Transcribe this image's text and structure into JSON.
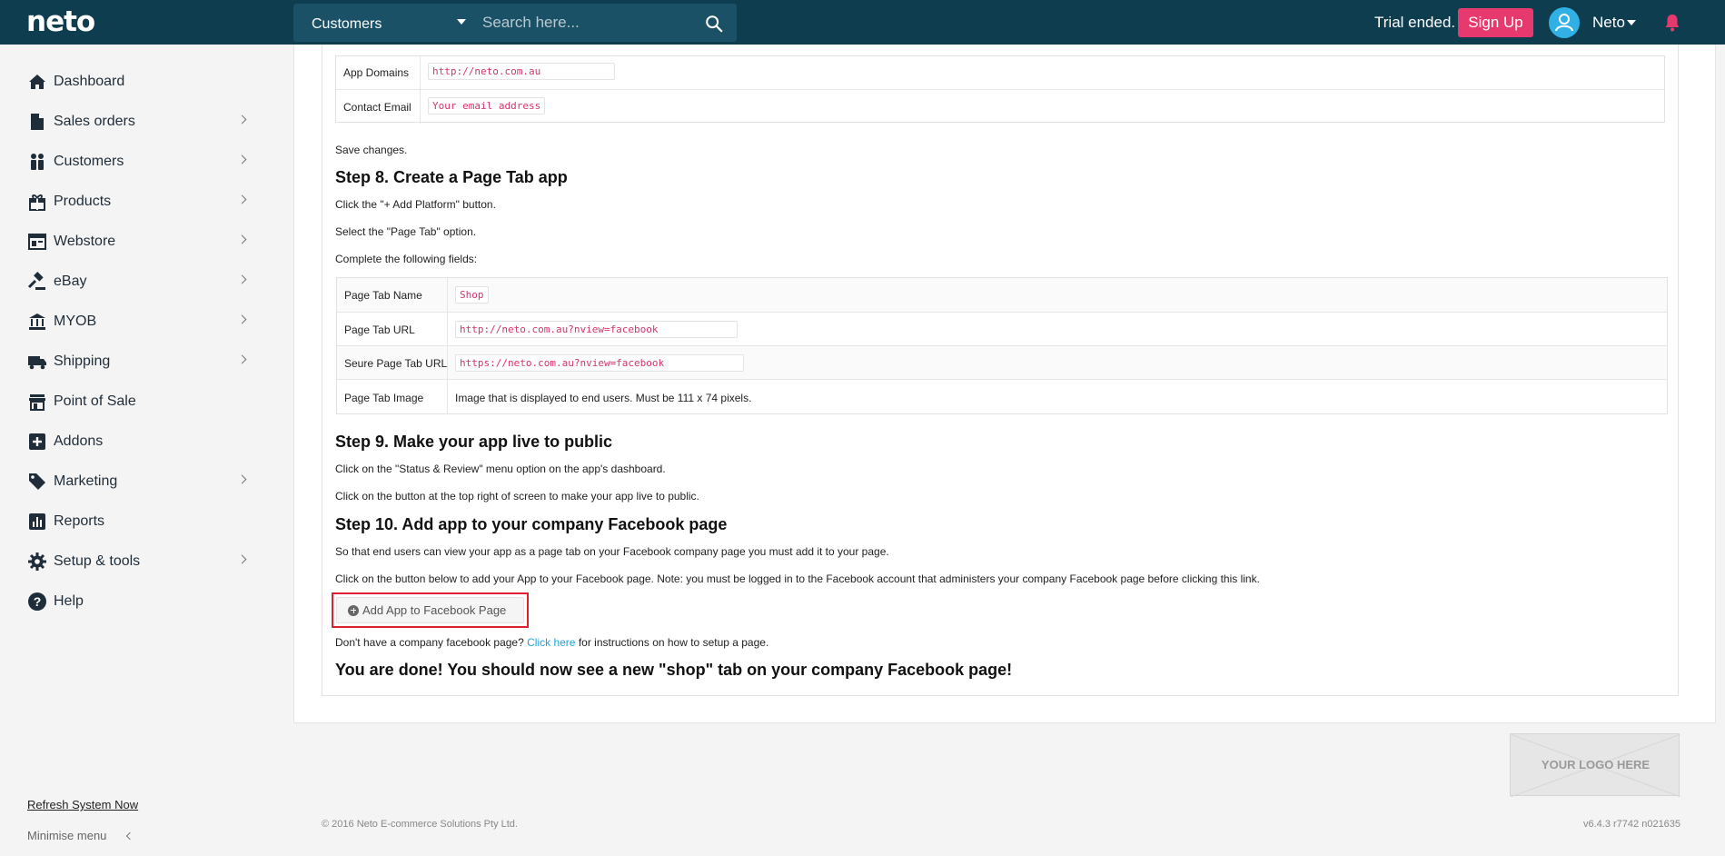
{
  "header": {
    "logo": "neto",
    "search_scope": "Customers",
    "search_placeholder": "Search here...",
    "trial_text": "Trial ended.",
    "signup_label": "Sign Up",
    "user_name": "Neto"
  },
  "sidebar": {
    "items": [
      {
        "label": "Dashboard",
        "icon": "home-icon",
        "has_children": false
      },
      {
        "label": "Sales orders",
        "icon": "document-icon",
        "has_children": true
      },
      {
        "label": "Customers",
        "icon": "people-icon",
        "has_children": true
      },
      {
        "label": "Products",
        "icon": "gift-icon",
        "has_children": true
      },
      {
        "label": "Webstore",
        "icon": "browser-icon",
        "has_children": true
      },
      {
        "label": "eBay",
        "icon": "gavel-icon",
        "has_children": true
      },
      {
        "label": "MYOB",
        "icon": "bank-icon",
        "has_children": true
      },
      {
        "label": "Shipping",
        "icon": "truck-icon",
        "has_children": true
      },
      {
        "label": "Point of Sale",
        "icon": "store-icon",
        "has_children": false
      },
      {
        "label": "Addons",
        "icon": "plus-square-icon",
        "has_children": false
      },
      {
        "label": "Marketing",
        "icon": "tag-icon",
        "has_children": true
      },
      {
        "label": "Reports",
        "icon": "bar-chart-icon",
        "has_children": false
      },
      {
        "label": "Setup & tools",
        "icon": "gear-icon",
        "has_children": true
      },
      {
        "label": "Help",
        "icon": "help-circle-icon",
        "has_children": false
      }
    ],
    "refresh_label": "Refresh System Now",
    "minimise_label": "Minimise menu"
  },
  "main": {
    "table1": {
      "rows": [
        {
          "label": "App Domains",
          "value": "http://neto.com.au"
        },
        {
          "label": "Contact Email",
          "value": "Your email address"
        }
      ]
    },
    "save_changes": "Save changes.",
    "step8": {
      "title": "Step 8. Create a Page Tab app",
      "lines": [
        "Click the \"+ Add Platform\" button.",
        "Select the \"Page Tab\" option.",
        "Complete the following fields:"
      ]
    },
    "table2": {
      "rows": [
        {
          "label": "Page Tab Name",
          "value": "Shop",
          "code": true
        },
        {
          "label": "Page Tab URL",
          "value": "http://neto.com.au?nview=facebook",
          "code": true
        },
        {
          "label": "Seure Page Tab URL",
          "value": "https://neto.com.au?nview=facebook",
          "code": true
        },
        {
          "label": "Page Tab Image",
          "value": "Image that is displayed to end users. Must be 111 x 74 pixels.",
          "code": false
        }
      ]
    },
    "step9": {
      "title": "Step 9. Make your app live to public",
      "lines": [
        "Click on the \"Status & Review\" menu option on the app's dashboard.",
        "Click on the button at the top right of screen to make your app live to public."
      ]
    },
    "step10": {
      "title": "Step 10. Add app to your company Facebook page",
      "lines": [
        "So that end users can view your app as a page tab on your Facebook company page you must add it to your page.",
        "Click on the button below to add your App to your Facebook page. Note: you must be logged in to the Facebook account that administers your company Facebook page before clicking this link."
      ],
      "button_label": "Add App to Facebook Page",
      "help_prefix": "Don't have a company facebook page?",
      "help_link": "Click here",
      "help_suffix": "for instructions on how to setup a page."
    },
    "done_text": "You are done! You should now see a new \"shop\" tab on your company Facebook page!"
  },
  "footer": {
    "logo_placeholder": "YOUR LOGO HERE",
    "copyright": "© 2016 Neto E-commerce Solutions Pty Ltd.",
    "version": "v6.4.3 r7742 n021635"
  },
  "colors": {
    "topbar": "#0d3d4f",
    "accent_pink": "#e63a6f",
    "link_blue": "#1fa3e0",
    "code_text": "#d6336c",
    "highlight_red": "#e0202e"
  }
}
